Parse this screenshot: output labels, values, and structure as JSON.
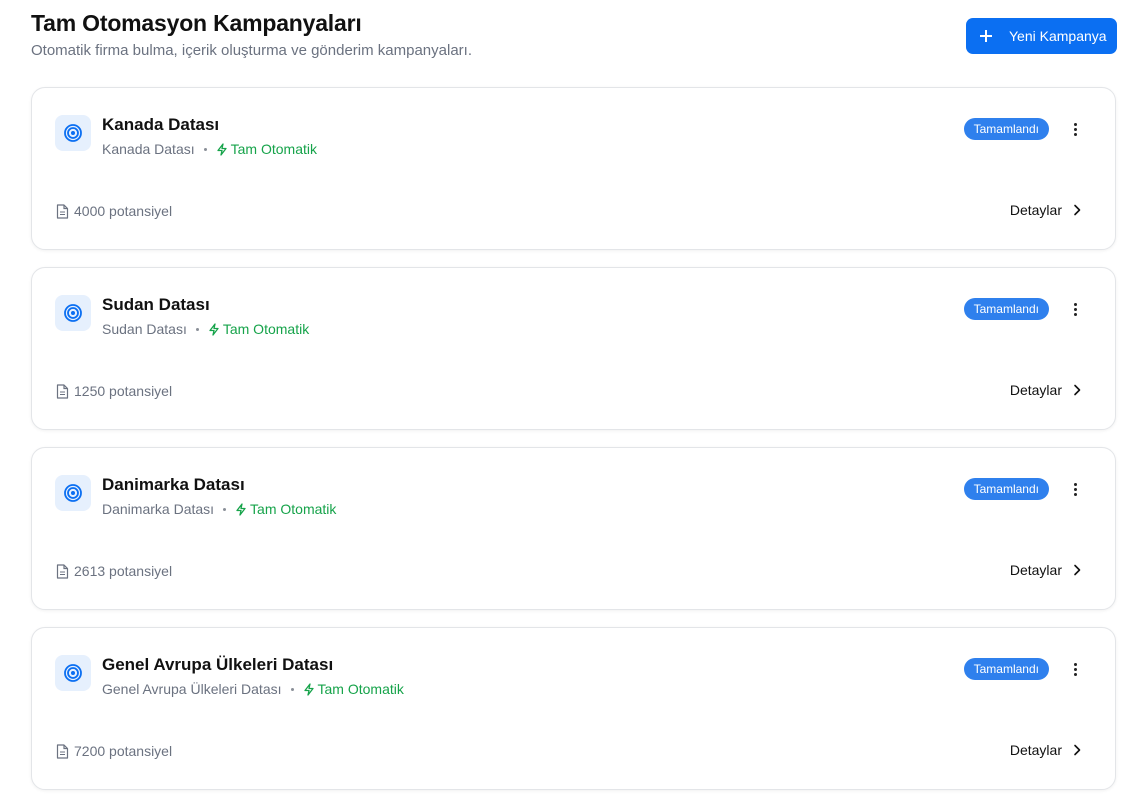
{
  "header": {
    "title": "Tam Otomasyon Kampanyaları",
    "subtitle": "Otomatik firma bulma, içerik oluşturma ve gönderim kampanyaları.",
    "new_button_label": "Yeni Kampanya"
  },
  "colors": {
    "accent": "#0b6ff2",
    "badge": "#2f80ed",
    "mode_green": "#16a34a",
    "icon_bg": "#e6f0fd"
  },
  "icons": {
    "campaign": "target-icon",
    "mode": "lightning-icon",
    "count": "document-icon",
    "more": "more-vertical-icon",
    "details": "chevron-right-icon",
    "add": "plus-icon"
  },
  "campaigns": [
    {
      "title": "Kanada Datası",
      "source": "Kanada Datası",
      "mode": "Tam Otomatik",
      "status": "Tamamlandı",
      "potential": "4000 potansiyel",
      "details_label": "Detaylar"
    },
    {
      "title": "Sudan Datası",
      "source": "Sudan Datası",
      "mode": "Tam Otomatik",
      "status": "Tamamlandı",
      "potential": "1250 potansiyel",
      "details_label": "Detaylar"
    },
    {
      "title": "Danimarka Datası",
      "source": "Danimarka Datası",
      "mode": "Tam Otomatik",
      "status": "Tamamlandı",
      "potential": "2613 potansiyel",
      "details_label": "Detaylar"
    },
    {
      "title": "Genel Avrupa Ülkeleri Datası",
      "source": "Genel Avrupa Ülkeleri Datası",
      "mode": "Tam Otomatik",
      "status": "Tamamlandı",
      "potential": "7200 potansiyel",
      "details_label": "Detaylar"
    }
  ]
}
